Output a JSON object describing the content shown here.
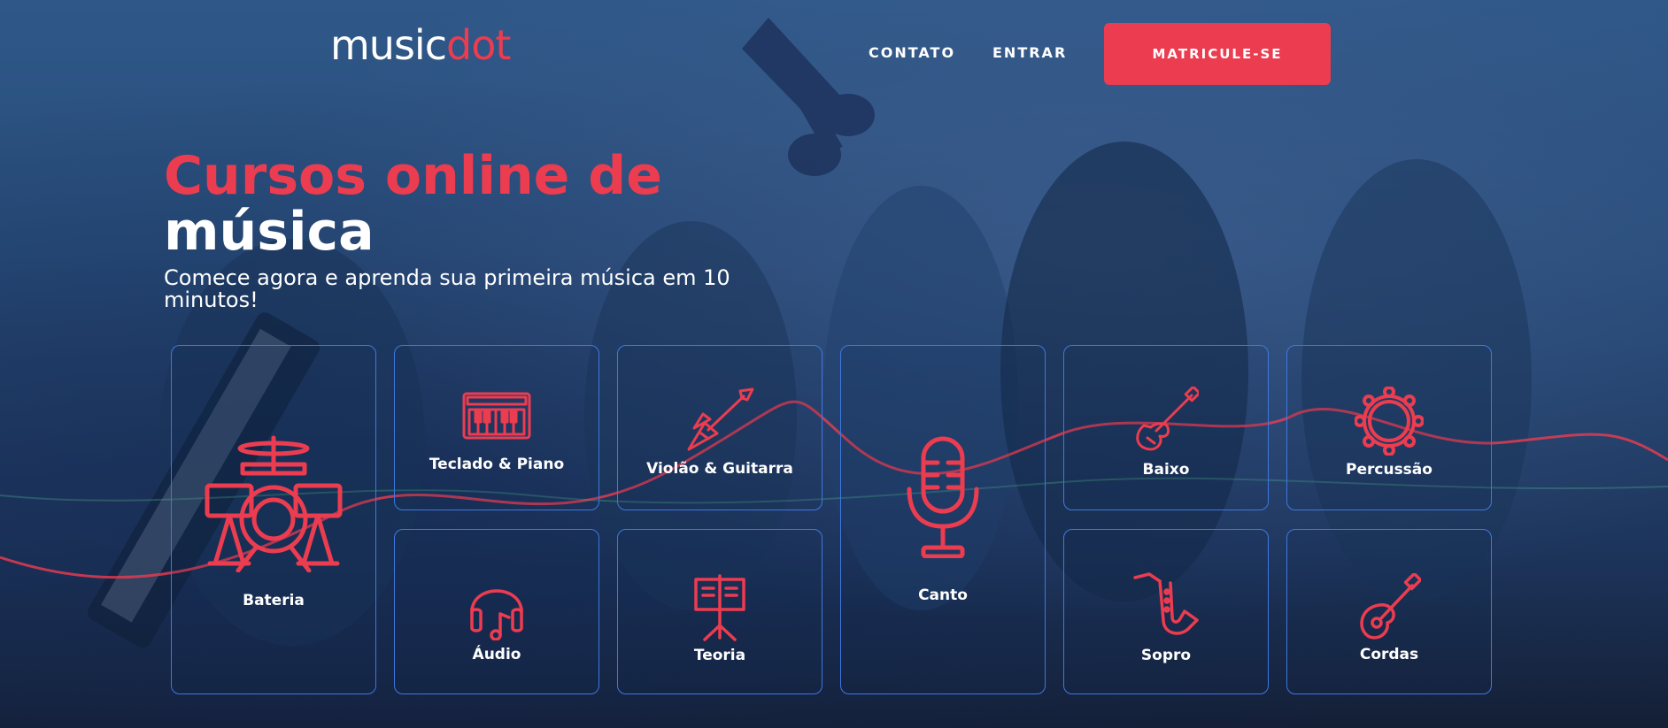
{
  "header": {
    "logo_main": "music",
    "logo_accent": "dot",
    "nav": [
      {
        "label": "CONTATO"
      },
      {
        "label": "ENTRAR"
      }
    ],
    "cta_label": "MATRICULE-SE"
  },
  "hero": {
    "title_line1": "Cursos online de",
    "title_line2": "música",
    "subtitle": "Comece agora e aprenda sua primeira música em 10 minutos!"
  },
  "courses": [
    {
      "label": "Bateria",
      "icon": "drum-kit-icon"
    },
    {
      "label": "Teclado & Piano",
      "icon": "keyboard-icon"
    },
    {
      "label": "Violão & Guitarra",
      "icon": "electric-guitar-icon"
    },
    {
      "label": "Canto",
      "icon": "microphone-icon"
    },
    {
      "label": "Baixo",
      "icon": "bass-guitar-icon"
    },
    {
      "label": "Percussão",
      "icon": "tambourine-icon"
    },
    {
      "label": "Áudio",
      "icon": "headphones-icon"
    },
    {
      "label": "Teoria",
      "icon": "music-stand-icon"
    },
    {
      "label": "Sopro",
      "icon": "saxophone-icon"
    },
    {
      "label": "Cordas",
      "icon": "ukulele-icon"
    }
  ],
  "colors": {
    "accent": "#ec3c50",
    "card_border": "#3f78e0",
    "background": "#1f3b63"
  }
}
